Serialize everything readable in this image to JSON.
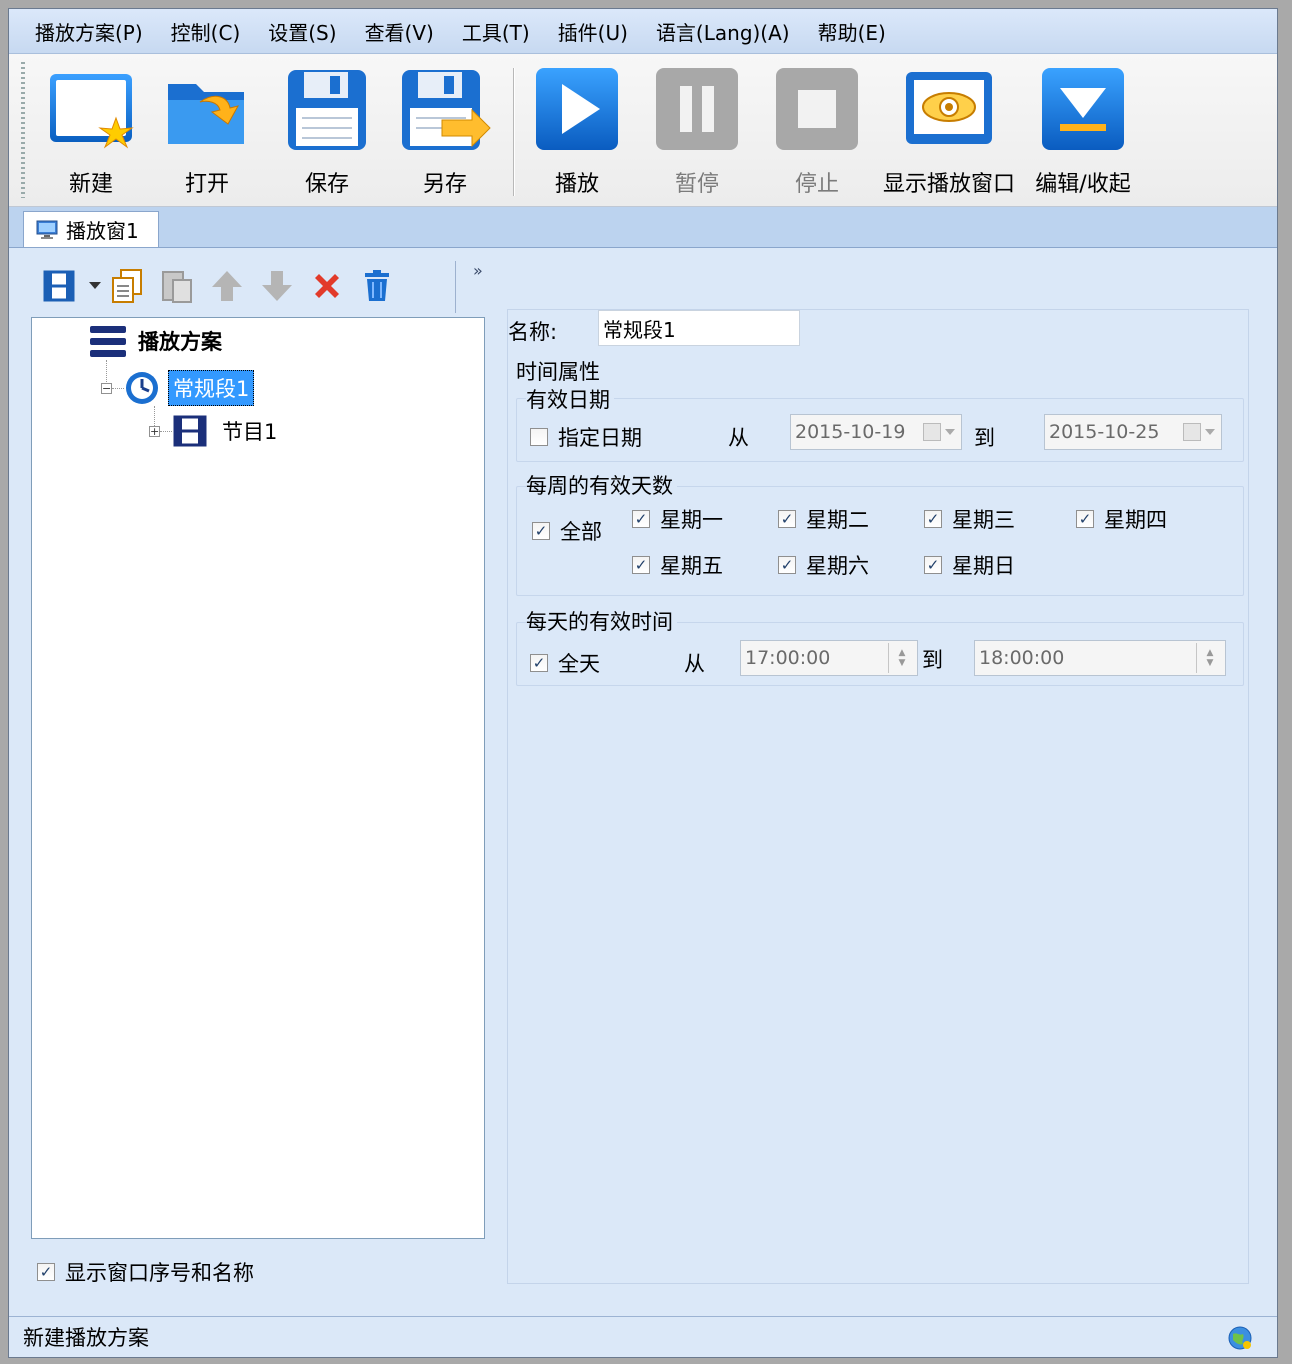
{
  "menu": [
    "播放方案(P)",
    "控制(C)",
    "设置(S)",
    "查看(V)",
    "工具(T)",
    "插件(U)",
    "语言(Lang)(A)",
    "帮助(E)"
  ],
  "toolbar": {
    "new": "新建",
    "open": "打开",
    "save": "保存",
    "save_as": "另存",
    "play": "播放",
    "pause": "暂停",
    "stop": "停止",
    "show_window": "显示播放窗口",
    "edit_collapse": "编辑/收起"
  },
  "tab": {
    "label": "播放窗1"
  },
  "tree": {
    "root": "播放方案",
    "segment": "常规段1",
    "program": "节目1"
  },
  "show_window_option": {
    "label": "显示窗口序号和名称",
    "checked": true
  },
  "form": {
    "name_label": "名称:",
    "name_value": "常规段1",
    "time_props": "时间属性",
    "valid_date": {
      "title": "有效日期",
      "specify_label": "指定日期",
      "specify_checked": false,
      "from_label": "从",
      "from_value": "2015-10-19",
      "to_label": "到",
      "to_value": "2015-10-25"
    },
    "weekly": {
      "title": "每周的有效天数",
      "all_label": "全部",
      "days": [
        "星期一",
        "星期二",
        "星期三",
        "星期四",
        "星期五",
        "星期六",
        "星期日"
      ]
    },
    "daily": {
      "title": "每天的有效时间",
      "all_day_label": "全天",
      "from_label": "从",
      "from_value": "17:00:00",
      "to_label": "到",
      "to_value": "18:00:00"
    }
  },
  "status": {
    "text": "新建播放方案"
  },
  "colors": {
    "accent": "#1a7fd6",
    "selection": "#3399ff",
    "delete": "#e23a2a"
  }
}
